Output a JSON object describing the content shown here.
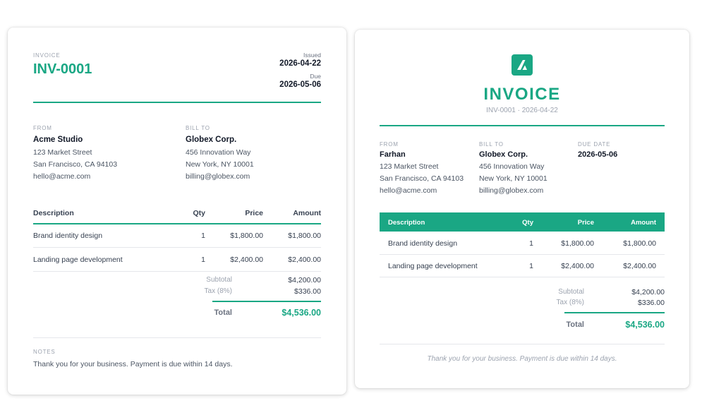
{
  "left": {
    "invoice_label": "INVOICE",
    "invoice_number": "INV-0001",
    "issued_label": "Issued",
    "issued_date": "2026-04-22",
    "due_label": "Due",
    "due_date": "2026-05-06",
    "from_label": "FROM",
    "from": {
      "name": "Acme Studio",
      "address1": "123 Market Street",
      "address2": "San Francisco, CA 94103",
      "email": "hello@acme.com"
    },
    "bill_label": "BILL TO",
    "bill": {
      "name": "Globex Corp.",
      "address1": "456 Innovation Way",
      "address2": "New York, NY 10001",
      "email": "billing@globex.com"
    },
    "columns": {
      "description": "Description",
      "qty": "Qty",
      "price": "Price",
      "amount": "Amount"
    },
    "items": [
      {
        "description": "Brand identity design",
        "qty": "1",
        "price": "$1,800.00",
        "amount": "$1,800.00"
      },
      {
        "description": "Landing page development",
        "qty": "1",
        "price": "$2,400.00",
        "amount": "$2,400.00"
      }
    ],
    "subtotal_label": "Subtotal",
    "subtotal": "$4,200.00",
    "tax_label": "Tax (8%)",
    "tax": "$336.00",
    "total_label": "Total",
    "total": "$4,536.00",
    "notes_label": "NOTES",
    "notes": "Thank you for your business. Payment is due within 14 days."
  },
  "right": {
    "title": "INVOICE",
    "subtitle": "INV-0001 · 2026-04-22",
    "from_label": "FROM",
    "from": {
      "name": "Farhan",
      "address1": "123 Market Street",
      "address2": "San Francisco, CA 94103",
      "email": "hello@acme.com"
    },
    "bill_label": "BILL TO",
    "bill": {
      "name": "Globex Corp.",
      "address1": "456 Innovation Way",
      "address2": "New York, NY 10001",
      "email": "billing@globex.com"
    },
    "due_label": "DUE DATE",
    "due_date": "2026-05-06",
    "columns": {
      "description": "Description",
      "qty": "Qty",
      "price": "Price",
      "amount": "Amount"
    },
    "items": [
      {
        "description": "Brand identity design",
        "qty": "1",
        "price": "$1,800.00",
        "amount": "$1,800.00"
      },
      {
        "description": "Landing page development",
        "qty": "1",
        "price": "$2,400.00",
        "amount": "$2,400.00"
      }
    ],
    "subtotal_label": "Subtotal",
    "subtotal": "$4,200.00",
    "tax_label": "Tax (8%)",
    "tax": "$336.00",
    "total_label": "Total",
    "total": "$4,536.00",
    "footer": "Thank you for your business. Payment is due within 14 days."
  },
  "colors": {
    "accent": "#1aa784"
  },
  "icons": {
    "logo": "logo-icon"
  }
}
